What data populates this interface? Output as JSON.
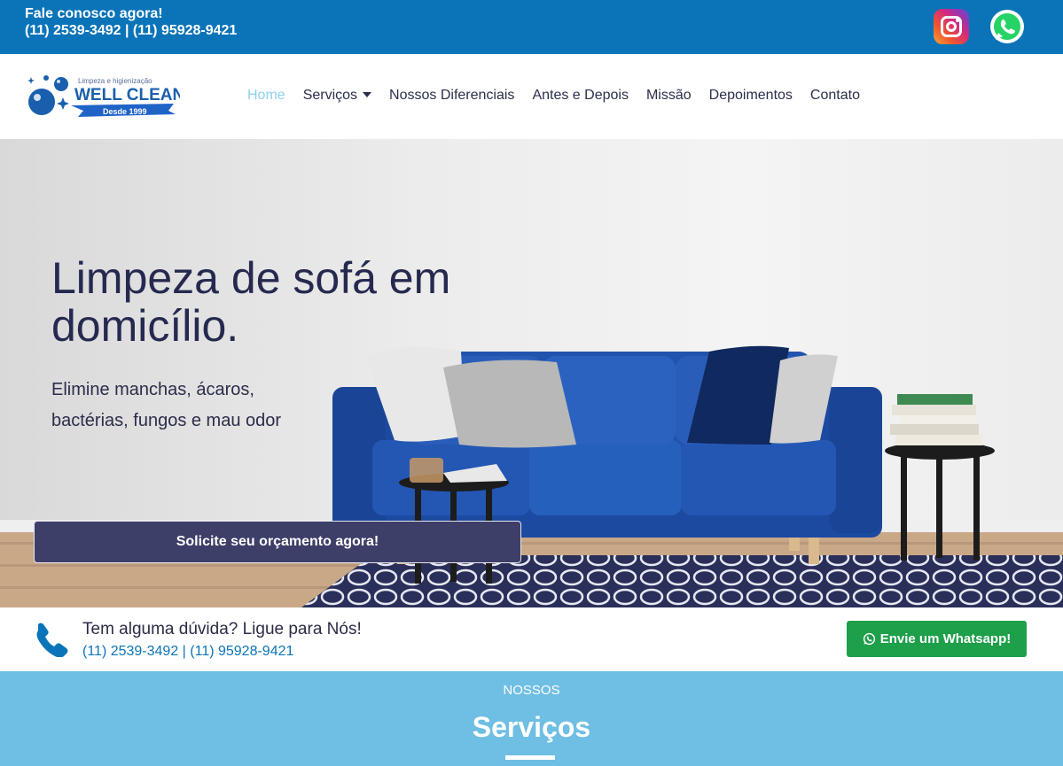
{
  "topbar": {
    "contact_title": "Fale conosco agora!",
    "contact_phones": "(11) 2539-3492 | (11) 95928-9421",
    "icons": [
      "instagram-icon",
      "whatsapp-icon"
    ]
  },
  "logo": {
    "tagline": "Limpeza e higienização",
    "brand": "WELL CLEAN",
    "since": "Desde 1999"
  },
  "nav": {
    "items": [
      {
        "label": "Home",
        "active": true
      },
      {
        "label": "Serviços",
        "dropdown": true
      },
      {
        "label": "Nossos Diferenciais"
      },
      {
        "label": "Antes e Depois"
      },
      {
        "label": "Missão"
      },
      {
        "label": "Depoimentos"
      },
      {
        "label": "Contato"
      }
    ],
    "active_color": "#8ed0ef",
    "text_color": "#2b2f4c"
  },
  "hero": {
    "title": "Limpeza de sofá em domicílio.",
    "subtitle": "Elimine manchas, ácaros, bactérias, fungos e mau odor",
    "cta_label": "Solicite seu orçamento agora!"
  },
  "callstrip": {
    "title": "Tem alguma dúvida? Ligue para Nós!",
    "phones": "(11) 2539-3492 | (11) 95928-9421",
    "whatsapp_label": "Envie um Whatsapp!"
  },
  "services": {
    "eyebrow": "NOSSOS",
    "title": "Serviços"
  },
  "colors": {
    "brand_blue": "#0b74b8",
    "navy": "#26294f",
    "whatsapp_green": "#1e9f4a",
    "services_bg": "#6fbee4"
  }
}
